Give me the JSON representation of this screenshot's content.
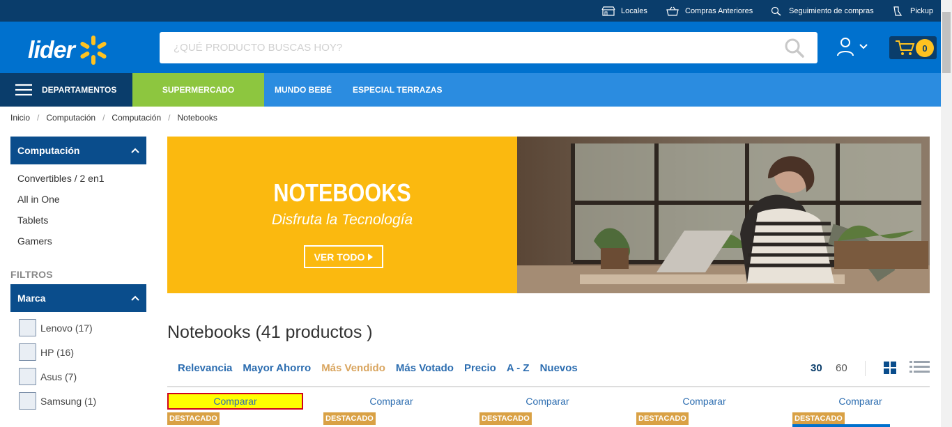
{
  "topbar": {
    "locales": "Locales",
    "compras": "Compras Anteriores",
    "seguimiento": "Seguimiento de compras",
    "pickup": "Pickup"
  },
  "header": {
    "logo": "lider",
    "search_placeholder": "¿QUÉ PRODUCTO BUSCAS HOY?",
    "cart_count": "0"
  },
  "nav": {
    "departamentos": "DEPARTAMENTOS",
    "supermercado": "SUPERMERCADO",
    "items": [
      "MUNDO BEBÉ",
      "ESPECIAL TERRAZAS"
    ]
  },
  "breadcrumb": [
    "Inicio",
    "Computación",
    "Computación",
    "Notebooks"
  ],
  "sidebar": {
    "category_title": "Computación",
    "categories": [
      "Convertibles / 2 en1",
      "All in One",
      "Tablets",
      "Gamers"
    ],
    "filtros_label": "FILTROS",
    "brand_title": "Marca",
    "brands": [
      "Lenovo (17)",
      "HP (16)",
      "Asus (7)",
      "Samsung (1)"
    ]
  },
  "banner": {
    "title": "NOTEBOOKS",
    "subtitle": "Disfruta la Tecnología",
    "button": "VER TODO"
  },
  "page_title": "Notebooks (41 productos )",
  "sort": {
    "options": [
      "Relevancia",
      "Mayor Ahorro",
      "Más Vendido",
      "Más Votado",
      "Precio",
      "A - Z",
      "Nuevos"
    ],
    "active": "Más Vendido"
  },
  "per_page": [
    "30",
    "60"
  ],
  "products": {
    "compare_label": "Comparar",
    "badge": "DESTACADO"
  },
  "colors": {
    "topbar": "#0a3d6b",
    "header": "#0071ce",
    "nav": "#2b8ce0",
    "supermercado": "#8dc63f",
    "banner": "#fbb90f",
    "accent": "#ffc220"
  }
}
